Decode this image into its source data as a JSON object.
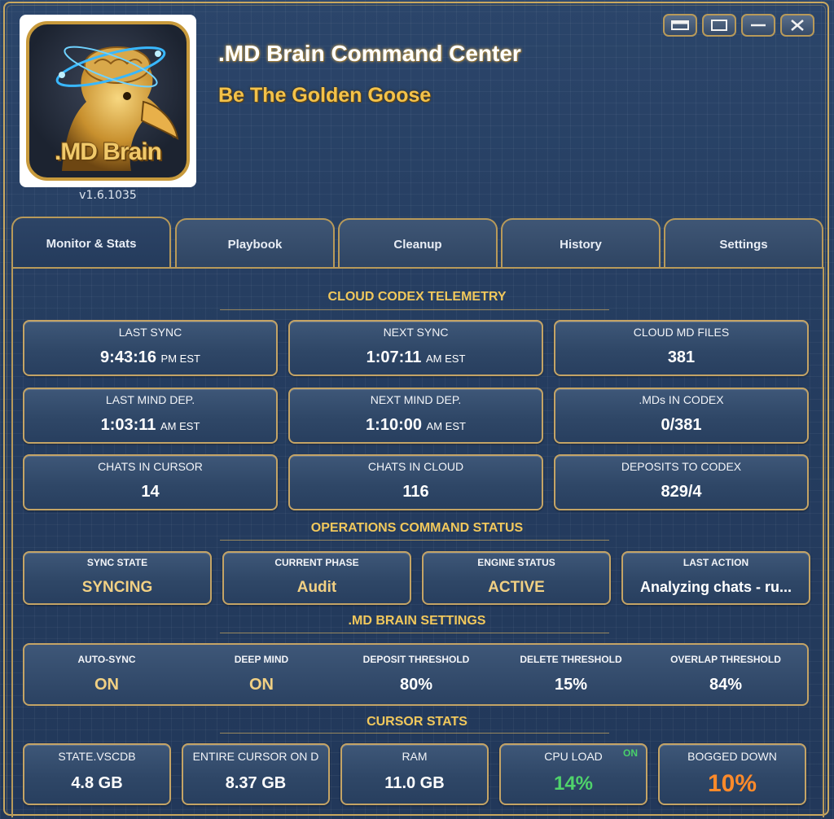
{
  "app": {
    "title": ".MD Brain Command Center",
    "subtitle": "Be The Golden Goose",
    "version": "v1.6.1035",
    "logo_text": ".MD Brain"
  },
  "window_buttons": [
    "restore-icon",
    "maximize-icon",
    "minimize-icon",
    "close-icon"
  ],
  "tabs": [
    {
      "label": "Monitor & Stats",
      "active": true
    },
    {
      "label": "Playbook",
      "active": false
    },
    {
      "label": "Cleanup",
      "active": false
    },
    {
      "label": "History",
      "active": false
    },
    {
      "label": "Settings",
      "active": false
    }
  ],
  "telemetry": {
    "title": "CLOUD  CODEX TELEMETRY",
    "cards": [
      {
        "label": "LAST SYNC",
        "value": "9:43:16",
        "suffix": "PM EST"
      },
      {
        "label": "NEXT SYNC",
        "value": "1:07:11",
        "suffix": "AM EST"
      },
      {
        "label": "CLOUD MD FILES",
        "value": "381",
        "suffix": ""
      },
      {
        "label": "LAST MIND DEP.",
        "value": "1:03:11",
        "suffix": "AM EST"
      },
      {
        "label": "NEXT MIND DEP.",
        "value": "1:10:00",
        "suffix": "AM EST"
      },
      {
        "label": ".MDs IN CODEX",
        "value": "0/381",
        "suffix": ""
      },
      {
        "label": "CHATS IN CURSOR",
        "value": "14",
        "suffix": ""
      },
      {
        "label": "CHATS IN CLOUD",
        "value": "116",
        "suffix": ""
      },
      {
        "label": "DEPOSITS TO CODEX",
        "value": "829/4",
        "suffix": ""
      }
    ]
  },
  "operations": {
    "title": "OPERATIONS COMMAND STATUS",
    "cards": [
      {
        "label": "SYNC STATE",
        "value": "SYNCING"
      },
      {
        "label": "CURRENT PHASE",
        "value": "Audit"
      },
      {
        "label": "ENGINE STATUS",
        "value": "ACTIVE"
      },
      {
        "label": "LAST ACTION",
        "value": "Analyzing chats - ru..."
      }
    ]
  },
  "brain_settings": {
    "title": ".MD BRAIN SETTINGS",
    "items": [
      {
        "label": "AUTO-SYNC",
        "value": "ON"
      },
      {
        "label": "DEEP MIND",
        "value": "ON"
      },
      {
        "label": "DEPOSIT THRESHOLD",
        "value": "80%"
      },
      {
        "label": "DELETE THRESHOLD",
        "value": "15%"
      },
      {
        "label": "OVERLAP THRESHOLD",
        "value": "84%"
      }
    ]
  },
  "cursor_stats": {
    "title": "CURSOR STATS",
    "cards": [
      {
        "label": "STATE.VSCDB",
        "value": "4.8 GB"
      },
      {
        "label": "ENTIRE  CURSOR  ON D",
        "value": "8.37 GB"
      },
      {
        "label": "RAM",
        "value": "11.0 GB"
      },
      {
        "label": "CPU LOAD",
        "value": "14%",
        "tag": "ON"
      },
      {
        "label": "BOGGED DOWN",
        "value": "10%"
      }
    ]
  },
  "colors": {
    "gold": "#c4a466",
    "gold_text": "#f1c85c",
    "on_value": "#f1d083",
    "cpu_green": "#4fd36b",
    "bogged_orange": "#ff8a2a"
  }
}
